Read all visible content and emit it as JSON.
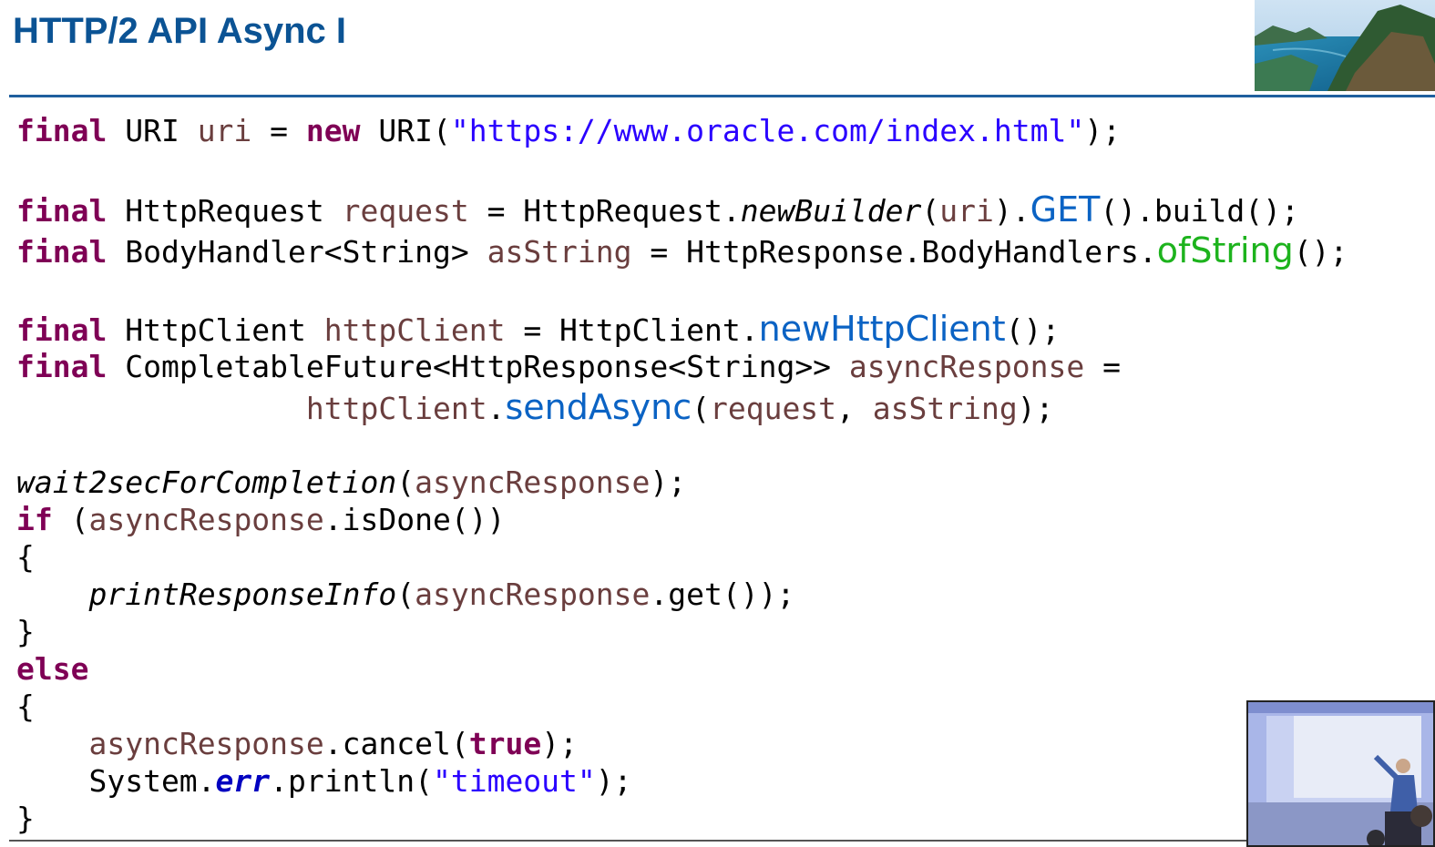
{
  "slide": {
    "title": "HTTP/2 API Async I"
  },
  "code_lines": [
    [
      {
        "t": "final",
        "c": "kw"
      },
      {
        "t": " URI ",
        "c": ""
      },
      {
        "t": "uri",
        "c": "var"
      },
      {
        "t": " = ",
        "c": ""
      },
      {
        "t": "new",
        "c": "kw"
      },
      {
        "t": " URI(",
        "c": ""
      },
      {
        "t": "\"https://www.oracle.com/index.html\"",
        "c": "str"
      },
      {
        "t": ");",
        "c": ""
      }
    ],
    [
      {
        "t": "final",
        "c": "kw"
      },
      {
        "t": " HttpRequest ",
        "c": ""
      },
      {
        "t": "request",
        "c": "var"
      },
      {
        "t": " = HttpRequest.",
        "c": ""
      },
      {
        "t": "newBuilder",
        "c": "it"
      },
      {
        "t": "(",
        "c": ""
      },
      {
        "t": "uri",
        "c": "var"
      },
      {
        "t": ").",
        "c": ""
      },
      {
        "t": "GET",
        "c": "m-blue"
      },
      {
        "t": "().build();",
        "c": ""
      }
    ],
    [
      {
        "t": "final",
        "c": "kw"
      },
      {
        "t": " BodyHandler<String> ",
        "c": ""
      },
      {
        "t": "asString",
        "c": "var"
      },
      {
        "t": " = HttpResponse.BodyHandlers.",
        "c": ""
      },
      {
        "t": "ofString",
        "c": "m-green"
      },
      {
        "t": "();",
        "c": ""
      }
    ],
    [
      {
        "t": "final",
        "c": "kw"
      },
      {
        "t": " HttpClient ",
        "c": ""
      },
      {
        "t": "httpClient",
        "c": "var"
      },
      {
        "t": " = HttpClient.",
        "c": ""
      },
      {
        "t": "newHttpClient",
        "c": "m-blue"
      },
      {
        "t": "();",
        "c": ""
      }
    ],
    [
      {
        "t": "final",
        "c": "kw"
      },
      {
        "t": " CompletableFuture<HttpResponse<String>> ",
        "c": ""
      },
      {
        "t": "asyncResponse",
        "c": "var"
      },
      {
        "t": " =",
        "c": ""
      }
    ],
    [
      {
        "t": "                ",
        "c": ""
      },
      {
        "t": "httpClient",
        "c": "var"
      },
      {
        "t": ".",
        "c": ""
      },
      {
        "t": "sendAsync",
        "c": "m-blue"
      },
      {
        "t": "(",
        "c": ""
      },
      {
        "t": "request",
        "c": "var"
      },
      {
        "t": ", ",
        "c": ""
      },
      {
        "t": "asString",
        "c": "var"
      },
      {
        "t": ");",
        "c": ""
      }
    ],
    [
      {
        "t": "wait2secForCompletion",
        "c": "it"
      },
      {
        "t": "(",
        "c": ""
      },
      {
        "t": "asyncResponse",
        "c": "var"
      },
      {
        "t": ");",
        "c": ""
      }
    ],
    [
      {
        "t": "if",
        "c": "kw"
      },
      {
        "t": " (",
        "c": ""
      },
      {
        "t": "asyncResponse",
        "c": "var"
      },
      {
        "t": ".isDone())",
        "c": ""
      }
    ],
    [
      {
        "t": "{",
        "c": ""
      }
    ],
    [
      {
        "t": "    ",
        "c": ""
      },
      {
        "t": "printResponseInfo",
        "c": "it"
      },
      {
        "t": "(",
        "c": ""
      },
      {
        "t": "asyncResponse",
        "c": "var"
      },
      {
        "t": ".get());",
        "c": ""
      }
    ],
    [
      {
        "t": "}",
        "c": ""
      }
    ],
    [
      {
        "t": "else",
        "c": "kw"
      }
    ],
    [
      {
        "t": "{",
        "c": ""
      }
    ],
    [
      {
        "t": "    ",
        "c": ""
      },
      {
        "t": "asyncResponse",
        "c": "var"
      },
      {
        "t": ".cancel(",
        "c": ""
      },
      {
        "t": "true",
        "c": "kw"
      },
      {
        "t": ");",
        "c": ""
      }
    ],
    [
      {
        "t": "    System.",
        "c": ""
      },
      {
        "t": "err",
        "c": "err"
      },
      {
        "t": ".println(",
        "c": ""
      },
      {
        "t": "\"timeout\"",
        "c": "str"
      },
      {
        "t": ");",
        "c": ""
      }
    ],
    [
      {
        "t": "}",
        "c": ""
      }
    ]
  ]
}
